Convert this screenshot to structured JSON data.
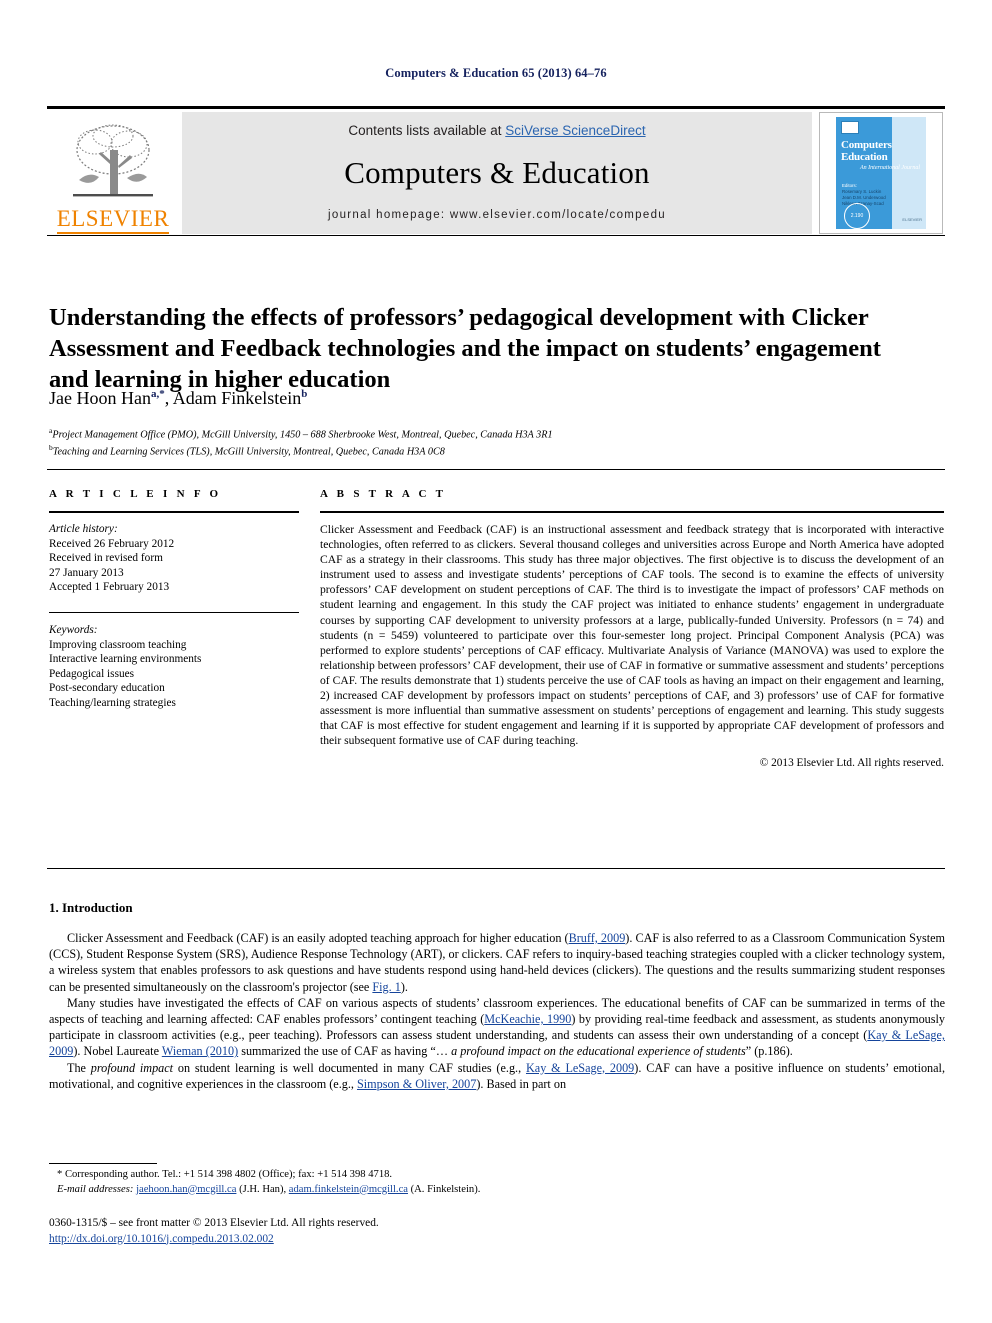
{
  "running_head": "Computers & Education 65 (2013) 64–76",
  "masthead": {
    "contents_prefix": "Contents lists available at ",
    "contents_link": "SciVerse ScienceDirect",
    "journal_name": "Computers & Education",
    "homepage": "journal homepage: www.elsevier.com/locate/compedu",
    "publisher_wordmark": "ELSEVIER",
    "cover": {
      "title_line1": "Computers",
      "title_amp": "&",
      "title_line2": "Education",
      "subtitle": "An International Journal",
      "editors_label": "Editors:",
      "editor1": "Rosemary S. Luckin",
      "editor2": "Jean D.M. Underwood",
      "editor3": "Nikleen Tzanay-Scad",
      "badge": "2.190",
      "publisher": "ELSEVIER"
    }
  },
  "article": {
    "title": "Understanding the effects of professors’ pedagogical development with Clicker Assessment and Feedback technologies and the impact on students’ engagement and learning in higher education",
    "authors_html": "Jae Hoon Han<sup>a,</sup><sup>*</sup>, Adam Finkelstein<sup>b</sup>",
    "affiliation_a": "Project Management Office (PMO), McGill University, 1450 – 688 Sherbrooke West, Montreal, Quebec, Canada H3A 3R1",
    "affiliation_b": "Teaching and Learning Services (TLS), McGill University, Montreal, Quebec, Canada H3A 0C8"
  },
  "article_info": {
    "heading": "A R T I C L E  I N F O",
    "history_label": "Article history:",
    "history_lines": [
      "Received 26 February 2012",
      "Received in revised form",
      "27 January 2013",
      "Accepted 1 February 2013"
    ],
    "keywords_label": "Keywords:",
    "keywords": [
      "Improving classroom teaching",
      "Interactive learning environments",
      "Pedagogical issues",
      "Post-secondary education",
      "Teaching/learning strategies"
    ]
  },
  "abstract": {
    "heading": "A B S T R A C T",
    "text": "Clicker Assessment and Feedback (CAF) is an instructional assessment and feedback strategy that is incorporated with interactive technologies, often referred to as clickers. Several thousand colleges and universities across Europe and North America have adopted CAF as a strategy in their classrooms. This study has three major objectives. The first objective is to discuss the development of an instrument used to assess and investigate students’ perceptions of CAF tools. The second is to examine the effects of university professors’ CAF development on student perceptions of CAF. The third is to investigate the impact of professors’ CAF methods on student learning and engagement. In this study the CAF project was initiated to enhance students’ engagement in undergraduate courses by supporting CAF development to university professors at a large, publically-funded University. Professors (n = 74) and students (n = 5459) volunteered to participate over this four-semester long project. Principal Component Analysis (PCA) was performed to explore students’ perceptions of CAF efficacy. Multivariate Analysis of Variance (MANOVA) was used to explore the relationship between professors’ CAF development, their use of CAF in formative or summative assessment and students’ perceptions of CAF. The results demonstrate that 1) students perceive the use of CAF tools as having an impact on their engagement and learning, 2) increased CAF development by professors impact on students’ perceptions of CAF, and 3) professors’ use of CAF for formative assessment is more influential than summative assessment on students’ perceptions of engagement and learning. This study suggests that CAF is most effective for student engagement and learning if it is supported by appropriate CAF development of professors and their subsequent formative use of CAF during teaching.",
    "copyright": "© 2013 Elsevier Ltd. All rights reserved."
  },
  "introduction": {
    "heading": "1. Introduction",
    "paragraph1_parts": {
      "p1a": "Clicker Assessment and Feedback (CAF) is an easily adopted teaching approach for higher education (",
      "cite_bruff": "Bruff, 2009",
      "p1b": "). CAF is also referred to as a Classroom Communication System (CCS), Student Response System (SRS), Audience Response Technology (ART), or clickers. CAF refers to inquiry-based teaching strategies coupled with a clicker technology system, a wireless system that enables professors to ask questions and have students respond using hand-held devices (clickers). The questions and the results summarizing student responses can be presented simultaneously on the classroom's projector (see ",
      "fig_ref": "Fig. 1",
      "p1c": ")."
    },
    "paragraph2_parts": {
      "p2a": "Many studies have investigated the effects of CAF on various aspects of students’ classroom experiences. The educational benefits of CAF can be summarized in terms of the aspects of teaching and learning affected: CAF enables professors’ contingent teaching (",
      "cite_mckeachie": "McKeachie, 1990",
      "p2b": ") by providing real-time feedback and assessment, as students anonymously participate in classroom activities (e.g., peer teaching). Professors can assess student understanding, and students can assess their own understanding of a concept (",
      "cite_kay1": "Kay & LeSage, 2009",
      "p2c": "). Nobel Laureate ",
      "cite_wieman": "Wieman (2010)",
      "p2d": " summarized the use of CAF as having “… ",
      "p2e": "a profound impact on the educational experience of students",
      "p2f": "” (p.186)."
    },
    "paragraph3_parts": {
      "p3a": "The ",
      "p3b": "profound impact",
      "p3c": " on student learning is well documented in many CAF studies (e.g., ",
      "cite_kay2": "Kay & LeSage, 2009",
      "p3d": "). CAF can have a positive influence on students’ emotional, motivational, and cognitive experiences in the classroom (e.g., ",
      "cite_simpson": "Simpson & Oliver, 2007",
      "p3e": "). Based in part on"
    }
  },
  "footnotes": {
    "corresponding": "* Corresponding author. Tel.: +1 514 398 4802 (Office); fax: +1 514 398 4718.",
    "email_label": "E-mail addresses:",
    "email1": "jaehoon.han@mcgill.ca",
    "email1_who": " (J.H. Han), ",
    "email2": "adam.finkelstein@mcgill.ca",
    "email2_who": " (A. Finkelstein)."
  },
  "imprint": {
    "line1": "0360-1315/$ – see front matter © 2013 Elsevier Ltd. All rights reserved.",
    "doi": "http://dx.doi.org/10.1016/j.compedu.2013.02.002"
  },
  "colors": {
    "running_head": "#15225e",
    "link": "#15449b",
    "elsevier_orange": "#ef8200",
    "sciverse_blue": "#2b65b0",
    "band_gray": "#e6e6e6"
  }
}
